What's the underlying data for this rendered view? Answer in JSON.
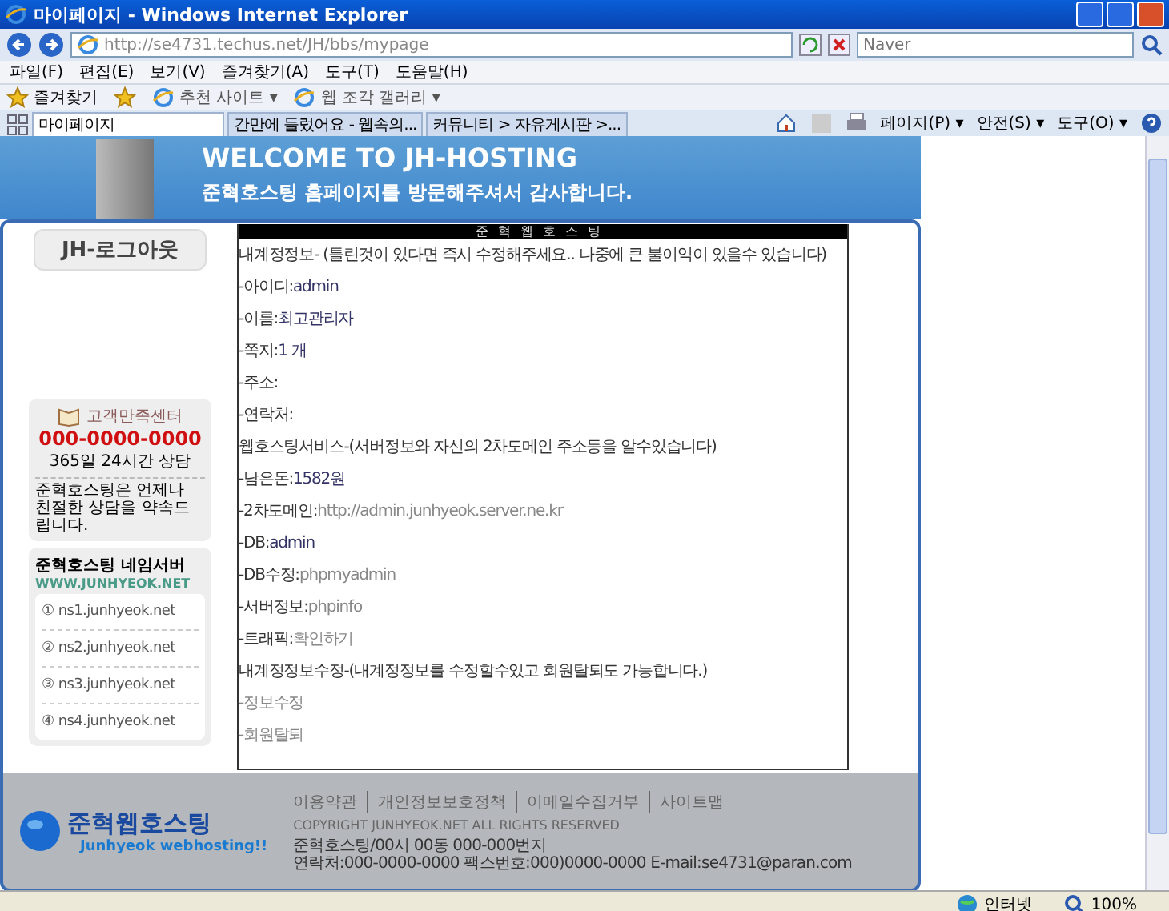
{
  "window": {
    "title": "마이페이지 - Windows Internet Explorer"
  },
  "address_bar": {
    "url": "http://se4731.techus.net/JH/bbs/mypage"
  },
  "search": {
    "placeholder": "Naver"
  },
  "menu": [
    "파일(F)",
    "편집(E)",
    "보기(V)",
    "즐겨찾기(A)",
    "도구(T)",
    "도움말(H)"
  ],
  "favorites_bar": {
    "label": "즐겨찾기",
    "links": [
      "추천 사이트 ▾",
      "웹 조각 갤러리 ▾"
    ]
  },
  "tabs": [
    {
      "label": "마이페이지",
      "selected": true
    },
    {
      "label": "간만에 들렀어요 - 웹속의...",
      "selected": false
    },
    {
      "label": "커뮤니티 > 자유게시판 >...",
      "selected": false
    }
  ],
  "command_bar": [
    "페이지(P) ▾",
    "안전(S) ▾",
    "도구(O) ▾"
  ],
  "banner": {
    "heading": "WELCOME TO JH-HOSTING",
    "subheading": "준혁호스팅 홈페이지를 방문해주셔서 감사합니다."
  },
  "sidebar": {
    "logout_button": "JH-로그아웃",
    "support": {
      "title": "고객만족센터",
      "phone": "000-0000-0000",
      "hours": "365일 24시간 상담",
      "note": "준혁호스팅은 언제나 친절한 상담을 약속드립니다."
    },
    "nameservers": {
      "title": "준혁호스팅 네임서버",
      "site": "WWW.JUNHYEOK.NET",
      "items": [
        "① ns1.junhyeok.net",
        "② ns2.junhyeok.net",
        "③ ns3.junhyeok.net",
        "④ ns4.junhyeok.net"
      ]
    }
  },
  "content": {
    "title": "준혁웹호스팅",
    "lines": [
      {
        "kind": "section",
        "label": "내계정정보- (틀린것이 있다면 즉시 수정해주세요.. 나중에 큰 불이익이 있을수 있습니다)"
      },
      {
        "kind": "field",
        "label": "-아이디:",
        "value": "admin"
      },
      {
        "kind": "field",
        "label": "-이름:",
        "value": "최고관리자"
      },
      {
        "kind": "field",
        "label": "-쪽지:",
        "value": "1 개"
      },
      {
        "kind": "field",
        "label": "-주소:"
      },
      {
        "kind": "field",
        "label": "-연락처:"
      },
      {
        "kind": "section",
        "label": "웹호스팅서비스-(서버정보와 자신의 2차도메인 주소등을 알수있습니다)"
      },
      {
        "kind": "field",
        "label": "-남은돈:",
        "value": "1582원"
      },
      {
        "kind": "link",
        "label": "-2차도메인:",
        "value": "http://admin.junhyeok.server.ne.kr"
      },
      {
        "kind": "field",
        "label": "-DB:",
        "value": "admin"
      },
      {
        "kind": "link",
        "label": "-DB수정:",
        "value": "phpmyadmin"
      },
      {
        "kind": "link",
        "label": "-서버정보:",
        "value": "phpinfo"
      },
      {
        "kind": "link",
        "label": "-트래픽:",
        "value": "확인하기"
      },
      {
        "kind": "section",
        "label": "내계정정보수정-(내계정정보를 수정할수있고 회원탈퇴도 가능합니다.)"
      },
      {
        "kind": "link",
        "label": "-정보수정"
      },
      {
        "kind": "link",
        "label": "-회원탈퇴"
      }
    ]
  },
  "footer": {
    "logo": "준혁웹호스팅",
    "slogan": "Junhyeok webhosting!!",
    "links": [
      "이용약관",
      "개인정보보호정책",
      "이메일수집거부",
      "사이트맵"
    ],
    "copyright": "COPYRIGHT JUNHYEOK.NET ALL RIGHTS RESERVED",
    "address": "준혁호스팅/00시 00동 000-000번지",
    "contact": "연락처:000-0000-0000 팩스번호:000)0000-0000 E-mail:se4731@paran.com"
  },
  "status_bar": {
    "zone": "인터넷",
    "zoom": "100%"
  }
}
